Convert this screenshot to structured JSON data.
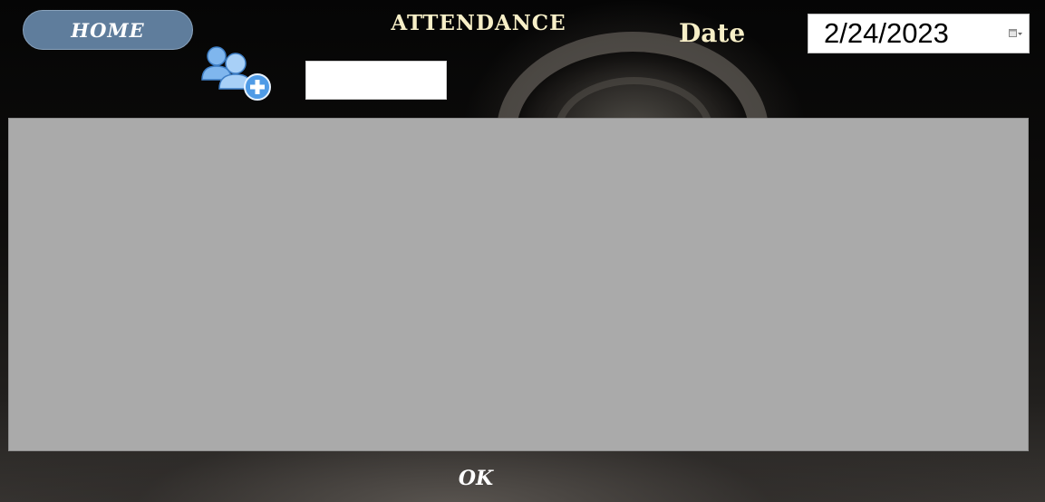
{
  "header": {
    "home_label": "HOME",
    "title": "ATTENDANCE",
    "add_member_icon": "add-users-icon"
  },
  "member_input": {
    "value": "",
    "placeholder": ""
  },
  "date": {
    "label": "Date",
    "value": "2/24/2023",
    "picker_icon": "calendar-dropdown-icon"
  },
  "attendance_panel": {
    "rows": []
  },
  "footer": {
    "ok_label": "OK"
  },
  "colors": {
    "home_button": "#5f7d9c",
    "title_text": "#f7efc7",
    "panel": "#aaaaaa",
    "icon_blue": "#4f9be6"
  }
}
